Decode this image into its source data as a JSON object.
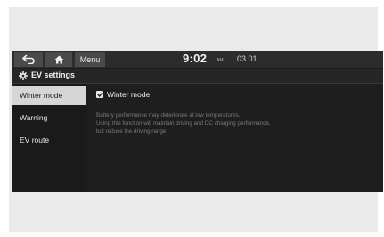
{
  "topbar": {
    "menu_label": "Menu",
    "time": "9:02",
    "ampm": "AM",
    "date": "03.01"
  },
  "titlebar": {
    "title": "EV settings",
    "icon": "gear-icon"
  },
  "sidebar": {
    "items": [
      {
        "label": "Winter mode",
        "active": true
      },
      {
        "label": "Warning",
        "active": false
      },
      {
        "label": "EV route",
        "active": false
      }
    ]
  },
  "content": {
    "checkbox_label": "Winter mode",
    "checkbox_checked": true,
    "description": [
      "Battery performance may deteriorate at low temperatures.",
      "Using this function will maintain driving and DC charging performance,",
      "but reduce the driving range."
    ]
  },
  "colors": {
    "screen_bg": "#1c1c1c",
    "active_item_bg": "#d6d6d6",
    "text_primary": "#f0f0f0",
    "text_secondary": "#7a7a7a"
  }
}
